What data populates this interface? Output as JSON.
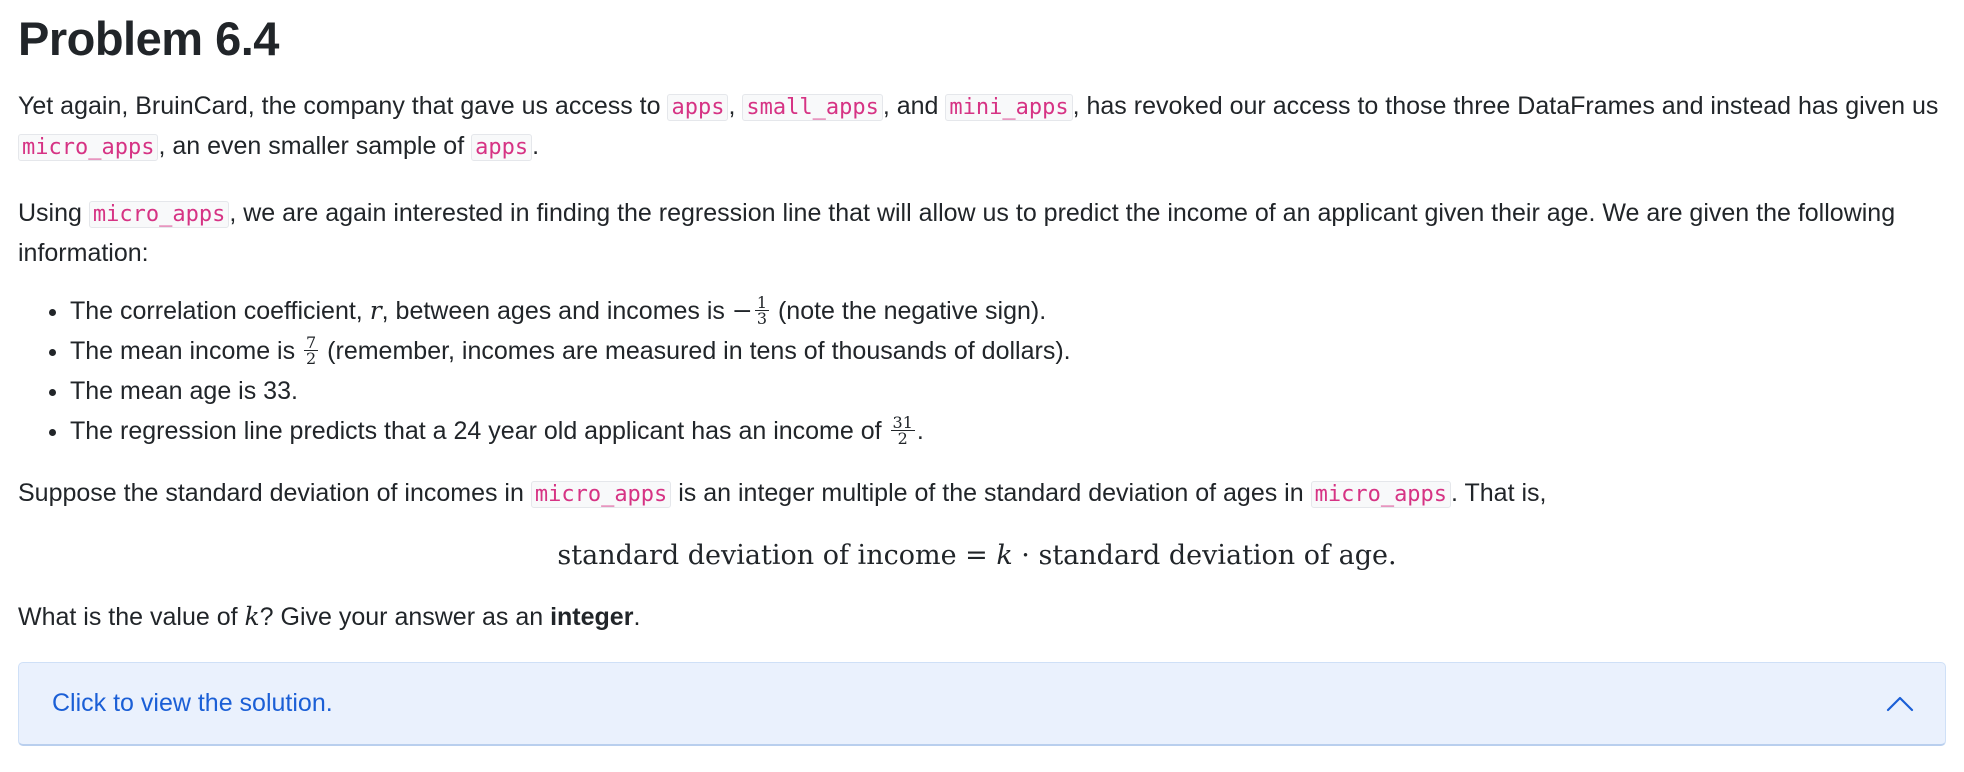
{
  "title": "Problem 6.4",
  "p1": {
    "t1": "Yet again, BruinCard, the company that gave us access to ",
    "c1": "apps",
    "t2": ", ",
    "c2": "small_apps",
    "t3": ", and ",
    "c3": "mini_apps",
    "t4": ", has revoked our access to those three DataFrames and instead has given us ",
    "c4": "micro_apps",
    "t5": ", an even smaller sample of ",
    "c5": "apps",
    "t6": "."
  },
  "p2": {
    "t1": "Using ",
    "c1": "micro_apps",
    "t2": ", we are again interested in finding the regression line that will allow us to predict the income of an applicant given their age. We are given the following information:"
  },
  "bullets": {
    "b1": {
      "t1": "The correlation coefficient, ",
      "var": "r",
      "t2": ", between ages and incomes is ",
      "sign": "−",
      "num": "1",
      "den": "3",
      "t3": " (note the negative sign)."
    },
    "b2": {
      "t1": "The mean income is ",
      "num": "7",
      "den": "2",
      "t2": " (remember, incomes are measured in tens of thousands of dollars)."
    },
    "b3": {
      "t1": "The mean age is 33."
    },
    "b4": {
      "t1": "The regression line predicts that a 24 year old applicant has an income of ",
      "num": "31",
      "den": "2",
      "t2": "."
    }
  },
  "p3": {
    "t1": "Suppose the standard deviation of incomes in ",
    "c1": "micro_apps",
    "t2": " is an integer multiple of the standard deviation of ages in ",
    "c2": "micro_apps",
    "t3": ". That is,"
  },
  "equation": {
    "left": "standard deviation of income",
    "eq": " = ",
    "var": "k",
    "dot": " · ",
    "right": "standard deviation of age."
  },
  "p4": {
    "t1": "What is the value of ",
    "var": "k",
    "t2": "? Give your answer as an ",
    "bold": "integer",
    "t3": "."
  },
  "solution": {
    "label": "Click to view the solution.",
    "icon": "chevron-up-icon",
    "accent": "#1b5fd6",
    "background": "#eaf1fd"
  }
}
